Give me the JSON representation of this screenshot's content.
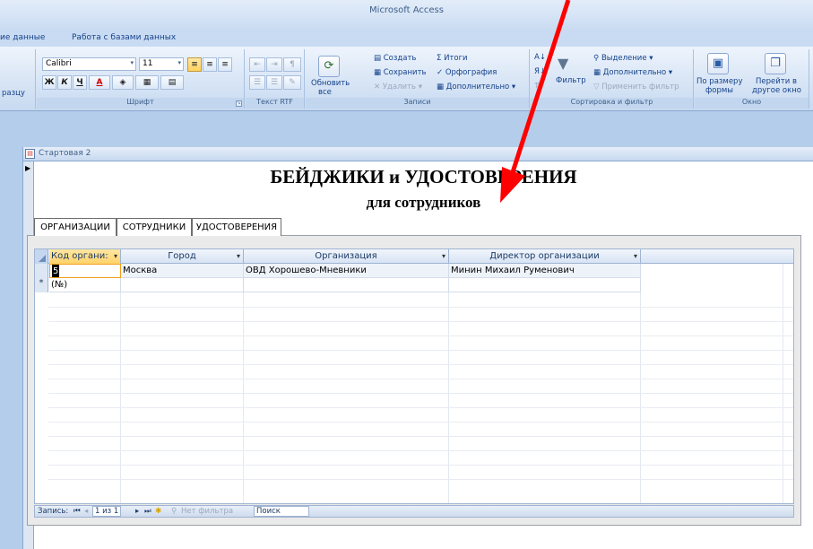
{
  "window": {
    "title": "Microsoft Access"
  },
  "ribbon_tabs": [
    "ие данные",
    "Работа с базами данных"
  ],
  "ribbon": {
    "clip_left": "разцу",
    "font": {
      "name": "Calibri",
      "size": "11",
      "bold": "Ж",
      "italic": "К",
      "underline": "Ч",
      "font_color": "А",
      "label": "Шрифт"
    },
    "rtf": {
      "label": "Текст RTF"
    },
    "records": {
      "refresh": "Обновить",
      "refresh_sub": "все",
      "create": "Создать",
      "save": "Сохранить",
      "delete": "Удалить",
      "totals": "Итоги",
      "spelling": "Орфография",
      "more": "Дополнительно",
      "label": "Записи"
    },
    "sort": {
      "filter": "Фильтр",
      "selection": "Выделение",
      "advanced": "Дополнительно",
      "apply_filter": "Применить фильтр",
      "label": "Сортировка и фильтр"
    },
    "window_group": {
      "fit_form": "По размеру",
      "fit_form2": "формы",
      "switch": "Перейти в",
      "switch2": "другое окно",
      "label": "Окно"
    }
  },
  "form": {
    "tab_name": "Стартовая 2",
    "heading_line1": "БЕЙДЖИКИ и УДОСТОВЕРЕНИЯ",
    "heading_line2": "для сотрудников",
    "tabs": [
      "ОРГАНИЗАЦИИ",
      "СОТРУДНИКИ",
      "УДОСТОВЕРЕНИЯ"
    ]
  },
  "datasheet": {
    "columns": [
      "Код органи:",
      "Город",
      "Организация",
      "Директор организации"
    ],
    "rows": [
      [
        "5",
        "Москва",
        "ОВД Хорошево-Мневники",
        "Минин Михаил Руменович"
      ]
    ],
    "new_row_marker": "*",
    "new_row_value": "(№)"
  },
  "navigator": {
    "record_label": "Запись:",
    "position": "1 из 1",
    "filter_status": "Нет фильтра",
    "search": "Поиск"
  },
  "colors": {
    "annotation_arrow": "#ff0000",
    "accent": "#ffd36b"
  }
}
